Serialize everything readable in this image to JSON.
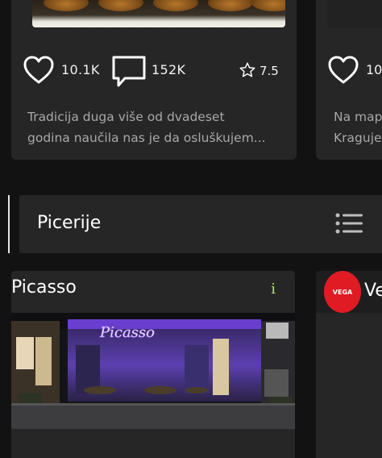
{
  "cards_top": [
    {
      "likes": "10.1K",
      "comments": "152K",
      "rating": "7.5",
      "description_lines": [
        "Tradicija duga više od dvadeset",
        "godina naučila nas je da osluškujem..."
      ]
    },
    {
      "likes": "10",
      "description_lines": [
        "Na map",
        "Kraguje"
      ]
    }
  ],
  "section": {
    "title": "Picerije"
  },
  "places": [
    {
      "name": "Picasso",
      "info_symbol": "i",
      "sign_text": "Picasso"
    },
    {
      "name": "Ve",
      "logo_text": "VEGA"
    }
  ],
  "colors": {
    "background": "#121212",
    "card": "#262626",
    "text_secondary": "#a8a8a8",
    "info_accent": "#b7e06b",
    "logo_red": "#e01b24",
    "neon_purple": "#8a4dff"
  },
  "icons": [
    "heart-icon",
    "comment-icon",
    "star-icon",
    "list-icon",
    "info-icon"
  ]
}
